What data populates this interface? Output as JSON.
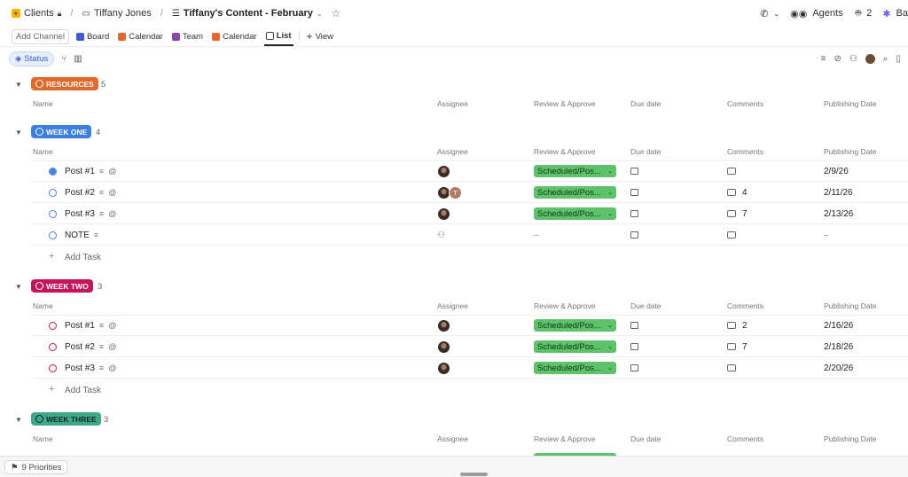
{
  "breadcrumb": {
    "workspace": "Clients",
    "folder": "Tiffany Jones",
    "list": "Tiffany's Content - February"
  },
  "topbar": {
    "agents_label": "Agents",
    "agents_count": "2",
    "brain_label": "Ba"
  },
  "views": {
    "add_channel": "Add Channel",
    "tabs": [
      {
        "label": "Board",
        "color": "#3b5ccc"
      },
      {
        "label": "Calendar",
        "color": "#e0692b"
      },
      {
        "label": "Team",
        "color": "#8e44ad"
      },
      {
        "label": "Calendar",
        "color": "#e0692b"
      },
      {
        "label": "List",
        "color": "#444444"
      }
    ],
    "add_view": "View"
  },
  "filters": {
    "status_label": "Status"
  },
  "columns": [
    "Name",
    "Assignee",
    "Review & Approve",
    "Due date",
    "Comments",
    "Publishing Date"
  ],
  "groups": [
    {
      "label": "RESOURCES",
      "count": "5",
      "color": "#e0692b"
    },
    {
      "label": "WEEK ONE",
      "count": "4",
      "color": "#3b7fe0",
      "tasks": [
        {
          "name": "Post #1",
          "review": "Scheduled/Pos...",
          "comments": "",
          "pubdate": "2/9/26"
        },
        {
          "name": "Post #2",
          "review": "Scheduled/Pos...",
          "comments": "4",
          "pubdate": "2/11/26",
          "second_assignee": "T"
        },
        {
          "name": "Post #3",
          "review": "Scheduled/Pos...",
          "comments": "7",
          "pubdate": "2/13/26"
        },
        {
          "name": "NOTE",
          "review": "–",
          "comments": "",
          "pubdate": "–"
        }
      ],
      "add_task": "Add Task"
    },
    {
      "label": "WEEK TWO",
      "count": "3",
      "color": "#c2185b",
      "tasks": [
        {
          "name": "Post #1",
          "review": "Scheduled/Pos...",
          "comments": "2",
          "pubdate": "2/16/26"
        },
        {
          "name": "Post #2",
          "review": "Scheduled/Pos...",
          "comments": "7",
          "pubdate": "2/18/26"
        },
        {
          "name": "Post #3",
          "review": "Scheduled/Pos...",
          "comments": "",
          "pubdate": "2/20/26"
        }
      ],
      "add_task": "Add Task"
    },
    {
      "label": "WEEK THREE",
      "count": "3",
      "color": "#3fa88a"
    }
  ],
  "bottombar": {
    "priorities": "9 Priorities"
  }
}
